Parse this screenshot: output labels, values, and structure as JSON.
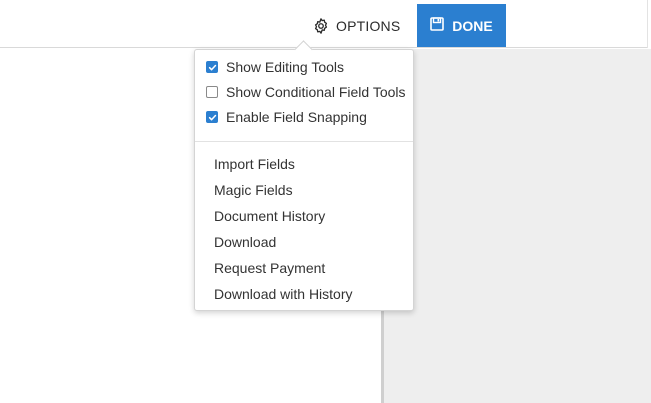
{
  "toolbar": {
    "options_label": "OPTIONS",
    "done_label": "DONE"
  },
  "options_menu": {
    "checkboxes": [
      {
        "label": "Show Editing Tools",
        "checked": true
      },
      {
        "label": "Show Conditional Field Tools",
        "checked": false
      },
      {
        "label": "Enable Field Snapping",
        "checked": true
      }
    ],
    "items": [
      {
        "label": "Import Fields"
      },
      {
        "label": "Magic Fields"
      },
      {
        "label": "Document History"
      },
      {
        "label": "Download"
      },
      {
        "label": "Request Payment"
      },
      {
        "label": "Download with History"
      }
    ]
  },
  "colors": {
    "accent": "#2b7fd0",
    "panel_bg": "#eeeeee",
    "text": "#333333"
  },
  "icons": {
    "options": "gear-icon",
    "done": "floppy-disk-icon",
    "checked": "checkmark-icon"
  }
}
